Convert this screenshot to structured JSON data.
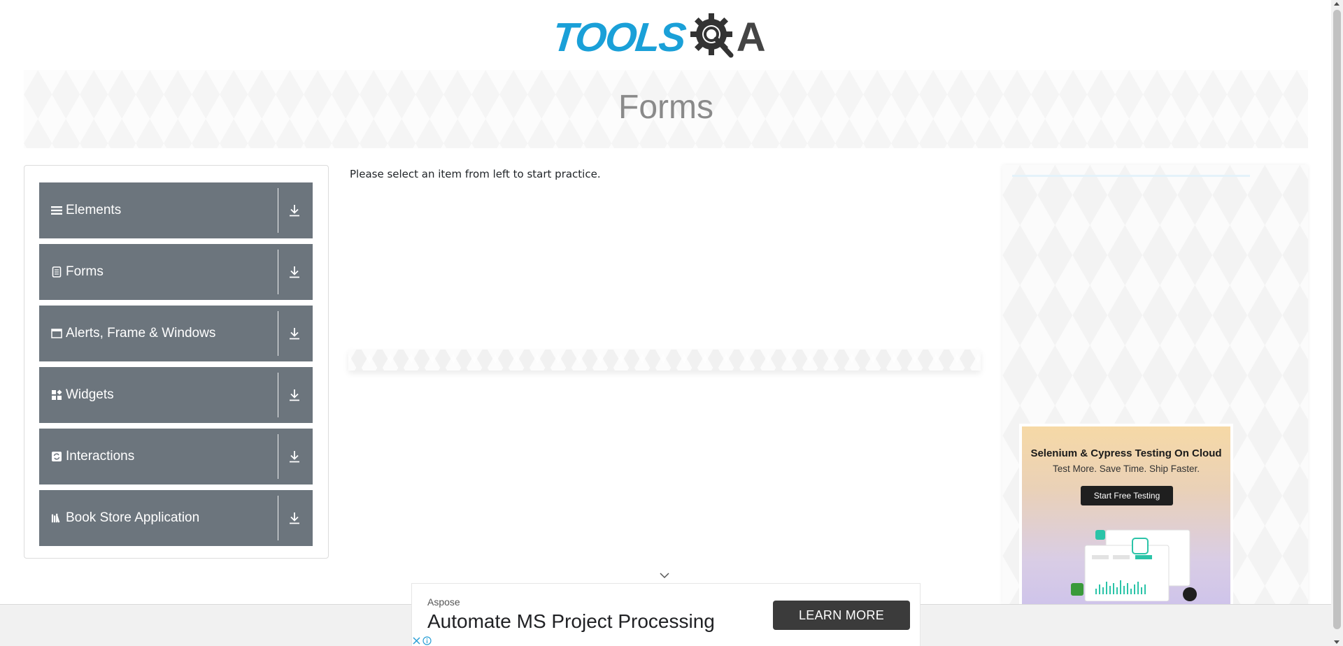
{
  "logo": {
    "text_blue": "TOOLS",
    "text_dark": "A",
    "colors": {
      "blue": "#1aa0d8",
      "dark": "#444444"
    }
  },
  "banner": {
    "title": "Forms"
  },
  "sidebar": {
    "groups": [
      {
        "label": "Elements",
        "icon": "list-icon"
      },
      {
        "label": "Forms",
        "icon": "document-icon"
      },
      {
        "label": "Alerts, Frame & Windows",
        "icon": "window-icon"
      },
      {
        "label": "Widgets",
        "icon": "widgets-icon"
      },
      {
        "label": "Interactions",
        "icon": "interactions-icon"
      },
      {
        "label": "Book Store Application",
        "icon": "books-icon"
      }
    ],
    "group_color": "#6c757d"
  },
  "main": {
    "instruction": "Please select an item from left to start practice."
  },
  "right_ad": {
    "title": "Selenium & Cypress Testing On Cloud",
    "subtitle": "Test More. Save Time. Ship Faster.",
    "button": "Start Free Testing"
  },
  "bottom_ad": {
    "brand": "Aspose",
    "headline": "Automate MS Project Processing",
    "button": "LEARN MORE"
  }
}
